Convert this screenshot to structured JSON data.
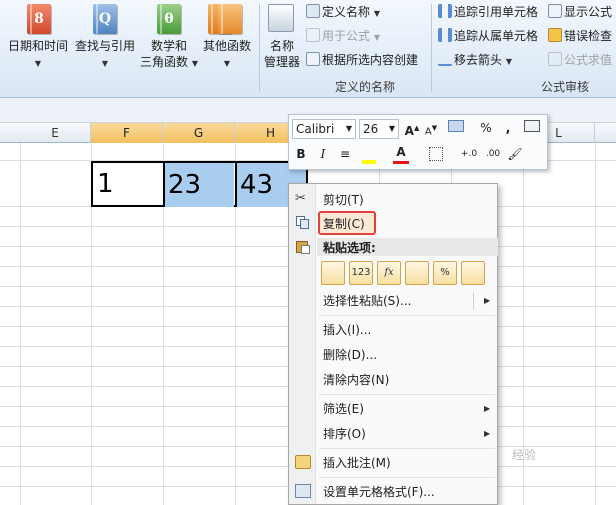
{
  "ribbon": {
    "buttons": [
      {
        "label": "日期和时间",
        "icon": "calendar-book-icon"
      },
      {
        "label": "查找与引用",
        "icon": "lookup-book-icon"
      },
      {
        "label": "数学和",
        "label2": "三角函数",
        "icon": "theta-book-icon"
      },
      {
        "label": "其他函数",
        "icon": "more-functions-book-icon"
      }
    ],
    "name_manager": {
      "label": "名称",
      "label2": "管理器"
    },
    "defined_names": {
      "define_name": "定义名称",
      "use_in_formula": "用于公式",
      "create_from_selection": "根据所选内容创建",
      "group_label": "定义的名称"
    },
    "audit": {
      "trace_precedents": "追踪引用单元格",
      "trace_dependents": "追踪从属单元格",
      "remove_arrows": "移去箭头",
      "show_formulas": "显示公式",
      "error_checking": "错误检查",
      "evaluate": "公式求值",
      "group_label": "公式审核"
    }
  },
  "grid": {
    "columns": [
      "E",
      "F",
      "G",
      "H",
      "",
      "",
      "L",
      ""
    ],
    "cells": {
      "F": "1",
      "G": "23",
      "H": "43"
    }
  },
  "mini_toolbar": {
    "font": "Calibri",
    "size": "26",
    "percent": "%",
    "comma": ",",
    "bold": "B",
    "italic": "I",
    "font_color_letter": "A",
    "inc_decimal": "+.0",
    "dec_decimal": ".00"
  },
  "context_menu": {
    "cut": "剪切(T)",
    "copy": "复制(C)",
    "paste_options": "粘贴选项:",
    "paste_icons": [
      "",
      "123",
      "fx",
      "",
      "%",
      ""
    ],
    "paste_special": "选择性粘贴(S)...",
    "insert": "插入(I)...",
    "delete": "删除(D)...",
    "clear": "清除内容(N)",
    "filter": "筛选(E)",
    "sort": "排序(O)",
    "insert_comment": "插入批注(M)",
    "format_cells": "设置单元格格式(F)..."
  },
  "watermark": "经验",
  "colors": {
    "selection": "#a9cdee",
    "header_selected": "#f1c15f",
    "highlight_box": "#e0433f"
  }
}
